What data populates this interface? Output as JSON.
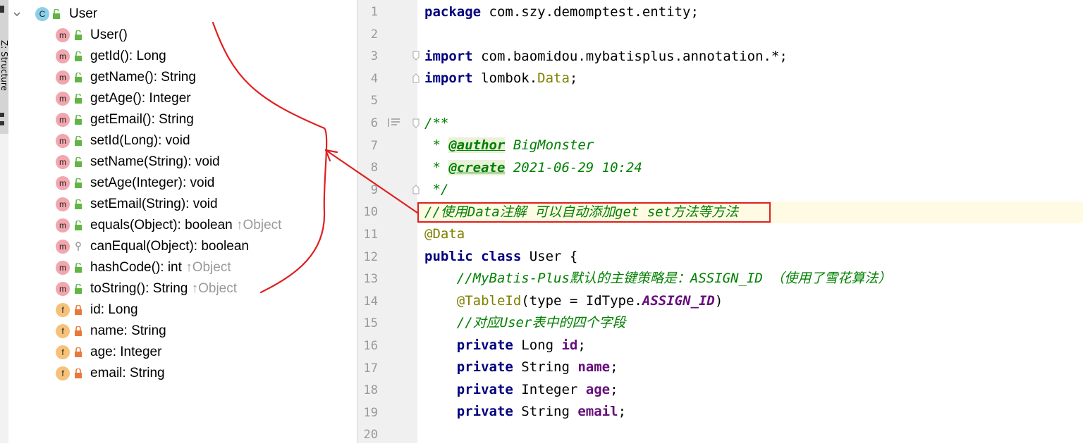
{
  "sidebar": {
    "tool_window_label": "Z: Structure"
  },
  "tree": {
    "root": {
      "icon": "class-icon",
      "kind_letter": "C",
      "label": "User"
    },
    "members": [
      {
        "kind": "method",
        "kind_letter": "m",
        "access": "public",
        "label": "User()",
        "inherited": ""
      },
      {
        "kind": "method",
        "kind_letter": "m",
        "access": "public",
        "label": "getId(): Long",
        "inherited": ""
      },
      {
        "kind": "method",
        "kind_letter": "m",
        "access": "public",
        "label": "getName(): String",
        "inherited": ""
      },
      {
        "kind": "method",
        "kind_letter": "m",
        "access": "public",
        "label": "getAge(): Integer",
        "inherited": ""
      },
      {
        "kind": "method",
        "kind_letter": "m",
        "access": "public",
        "label": "getEmail(): String",
        "inherited": ""
      },
      {
        "kind": "method",
        "kind_letter": "m",
        "access": "public",
        "label": "setId(Long): void",
        "inherited": ""
      },
      {
        "kind": "method",
        "kind_letter": "m",
        "access": "public",
        "label": "setName(String): void",
        "inherited": ""
      },
      {
        "kind": "method",
        "kind_letter": "m",
        "access": "public",
        "label": "setAge(Integer): void",
        "inherited": ""
      },
      {
        "kind": "method",
        "kind_letter": "m",
        "access": "public",
        "label": "setEmail(String): void",
        "inherited": ""
      },
      {
        "kind": "method",
        "kind_letter": "m",
        "access": "public",
        "label": "equals(Object): boolean",
        "inherited": "↑Object"
      },
      {
        "kind": "method",
        "kind_letter": "m",
        "access": "protected",
        "label": "canEqual(Object): boolean",
        "inherited": ""
      },
      {
        "kind": "method",
        "kind_letter": "m",
        "access": "public",
        "label": "hashCode(): int",
        "inherited": "↑Object"
      },
      {
        "kind": "method",
        "kind_letter": "m",
        "access": "public",
        "label": "toString(): String",
        "inherited": "↑Object"
      },
      {
        "kind": "field",
        "kind_letter": "f",
        "access": "private",
        "label": "id: Long",
        "inherited": ""
      },
      {
        "kind": "field",
        "kind_letter": "f",
        "access": "private",
        "label": "name: String",
        "inherited": ""
      },
      {
        "kind": "field",
        "kind_letter": "f",
        "access": "private",
        "label": "age: Integer",
        "inherited": ""
      },
      {
        "kind": "field",
        "kind_letter": "f",
        "access": "private",
        "label": "email: String",
        "inherited": ""
      }
    ]
  },
  "editor": {
    "line_numbers": [
      "1",
      "2",
      "3",
      "4",
      "5",
      "6",
      "7",
      "8",
      "9",
      "10",
      "11",
      "12",
      "13",
      "14",
      "15",
      "16",
      "17",
      "18",
      "19",
      "20"
    ],
    "highlighted_line": "10",
    "lines": {
      "l1_kw": "package",
      "l1_rest": " com.szy.demomptest.entity;",
      "l3_kw": "import",
      "l3_rest": " com.baomidou.mybatisplus.annotation.*;",
      "l4_kw": "import",
      "l4_a": " lombok.",
      "l4_ann": "Data",
      "l4_b": ";",
      "l6": "/**",
      "l7_a": " * ",
      "l7_tag": "@author",
      "l7_b": " BigMonster",
      "l8_a": " * ",
      "l8_tag": "@create",
      "l8_b": " 2021-06-29 10:24",
      "l9": " */",
      "l10": "//使用Data注解 可以自动添加get set方法等方法",
      "l11": "@Data",
      "l12_kw": "public class",
      "l12_rest": " User {",
      "l13": "    //MyBatis-Plus默认的主键策略是：ASSIGN_ID （使用了雪花算法）",
      "l14_ind": "    ",
      "l14_ann": "@TableId",
      "l14_a": "(type = IdType.",
      "l14_cst": "ASSIGN_ID",
      "l14_b": ")",
      "l15": "    //对应User表中的四个字段",
      "l16_kw": "    private",
      "l16_t": " Long ",
      "l16_f": "id",
      "l16_e": ";",
      "l17_kw": "    private",
      "l17_t": " String ",
      "l17_f": "name",
      "l17_e": ";",
      "l18_kw": "    private",
      "l18_t": " Integer ",
      "l18_f": "age",
      "l18_e": ";",
      "l19_kw": "    private",
      "l19_t": " String ",
      "l19_f": "email",
      "l19_e": ";"
    }
  },
  "colors": {
    "annotation_red": "#e02020",
    "keyword": "#000080",
    "comment": "#008000",
    "field": "#660e7a"
  }
}
